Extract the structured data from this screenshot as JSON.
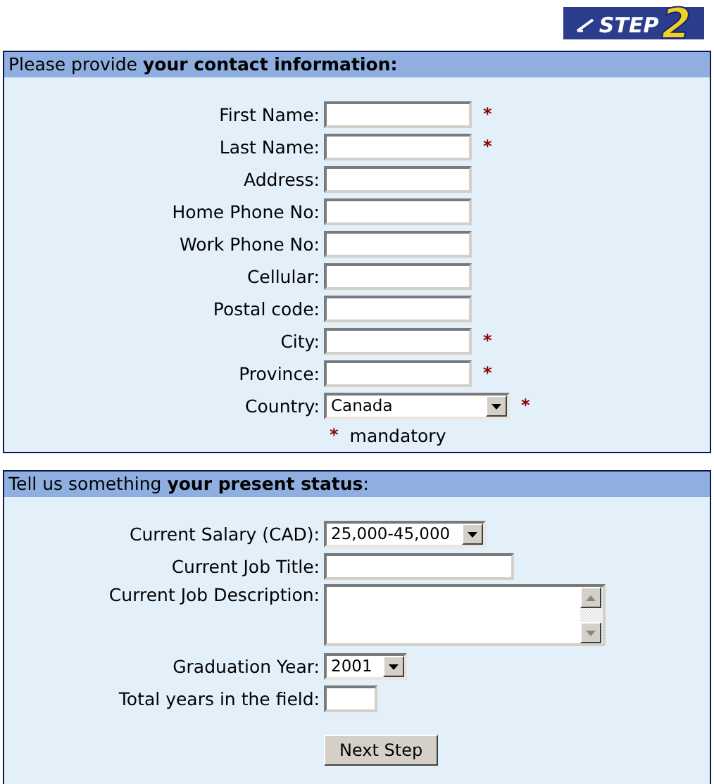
{
  "logo": {
    "word": "STEP",
    "number": "2"
  },
  "sections": [
    {
      "title": "Please provide **your contact information:**",
      "mandatory_note": {
        "mark": "*",
        "text": "mandatory"
      },
      "fields": [
        {
          "kind": "text",
          "label": "First Name:",
          "required": true
        },
        {
          "kind": "text",
          "label": "Last Name:",
          "required": true
        },
        {
          "kind": "text",
          "label": "Address:",
          "required": false
        },
        {
          "kind": "text",
          "label": "Home Phone No:",
          "required": false
        },
        {
          "kind": "text",
          "label": "Work Phone No:",
          "required": false
        },
        {
          "kind": "text",
          "label": "Cellular:",
          "required": false
        },
        {
          "kind": "text",
          "label": "Postal code:",
          "required": false
        },
        {
          "kind": "text",
          "label": "City:",
          "required": true
        },
        {
          "kind": "text",
          "label": "Province:",
          "required": true
        },
        {
          "kind": "wide-select",
          "label": "Country:",
          "value": "Canada",
          "required": true
        }
      ]
    },
    {
      "title": "Tell us something **your present status**:",
      "fields": [
        {
          "kind": "select",
          "label": "Current Salary (CAD):",
          "value": "25,000-45,000"
        },
        {
          "kind": "long-text",
          "label": "Current Job Title:"
        },
        {
          "kind": "textarea",
          "label": "Current Job Description:"
        },
        {
          "kind": "select",
          "label": "Graduation Year:",
          "value": "2001"
        },
        {
          "kind": "short-text",
          "label": "Total years in the field:"
        }
      ],
      "button": "Next Step"
    }
  ]
}
